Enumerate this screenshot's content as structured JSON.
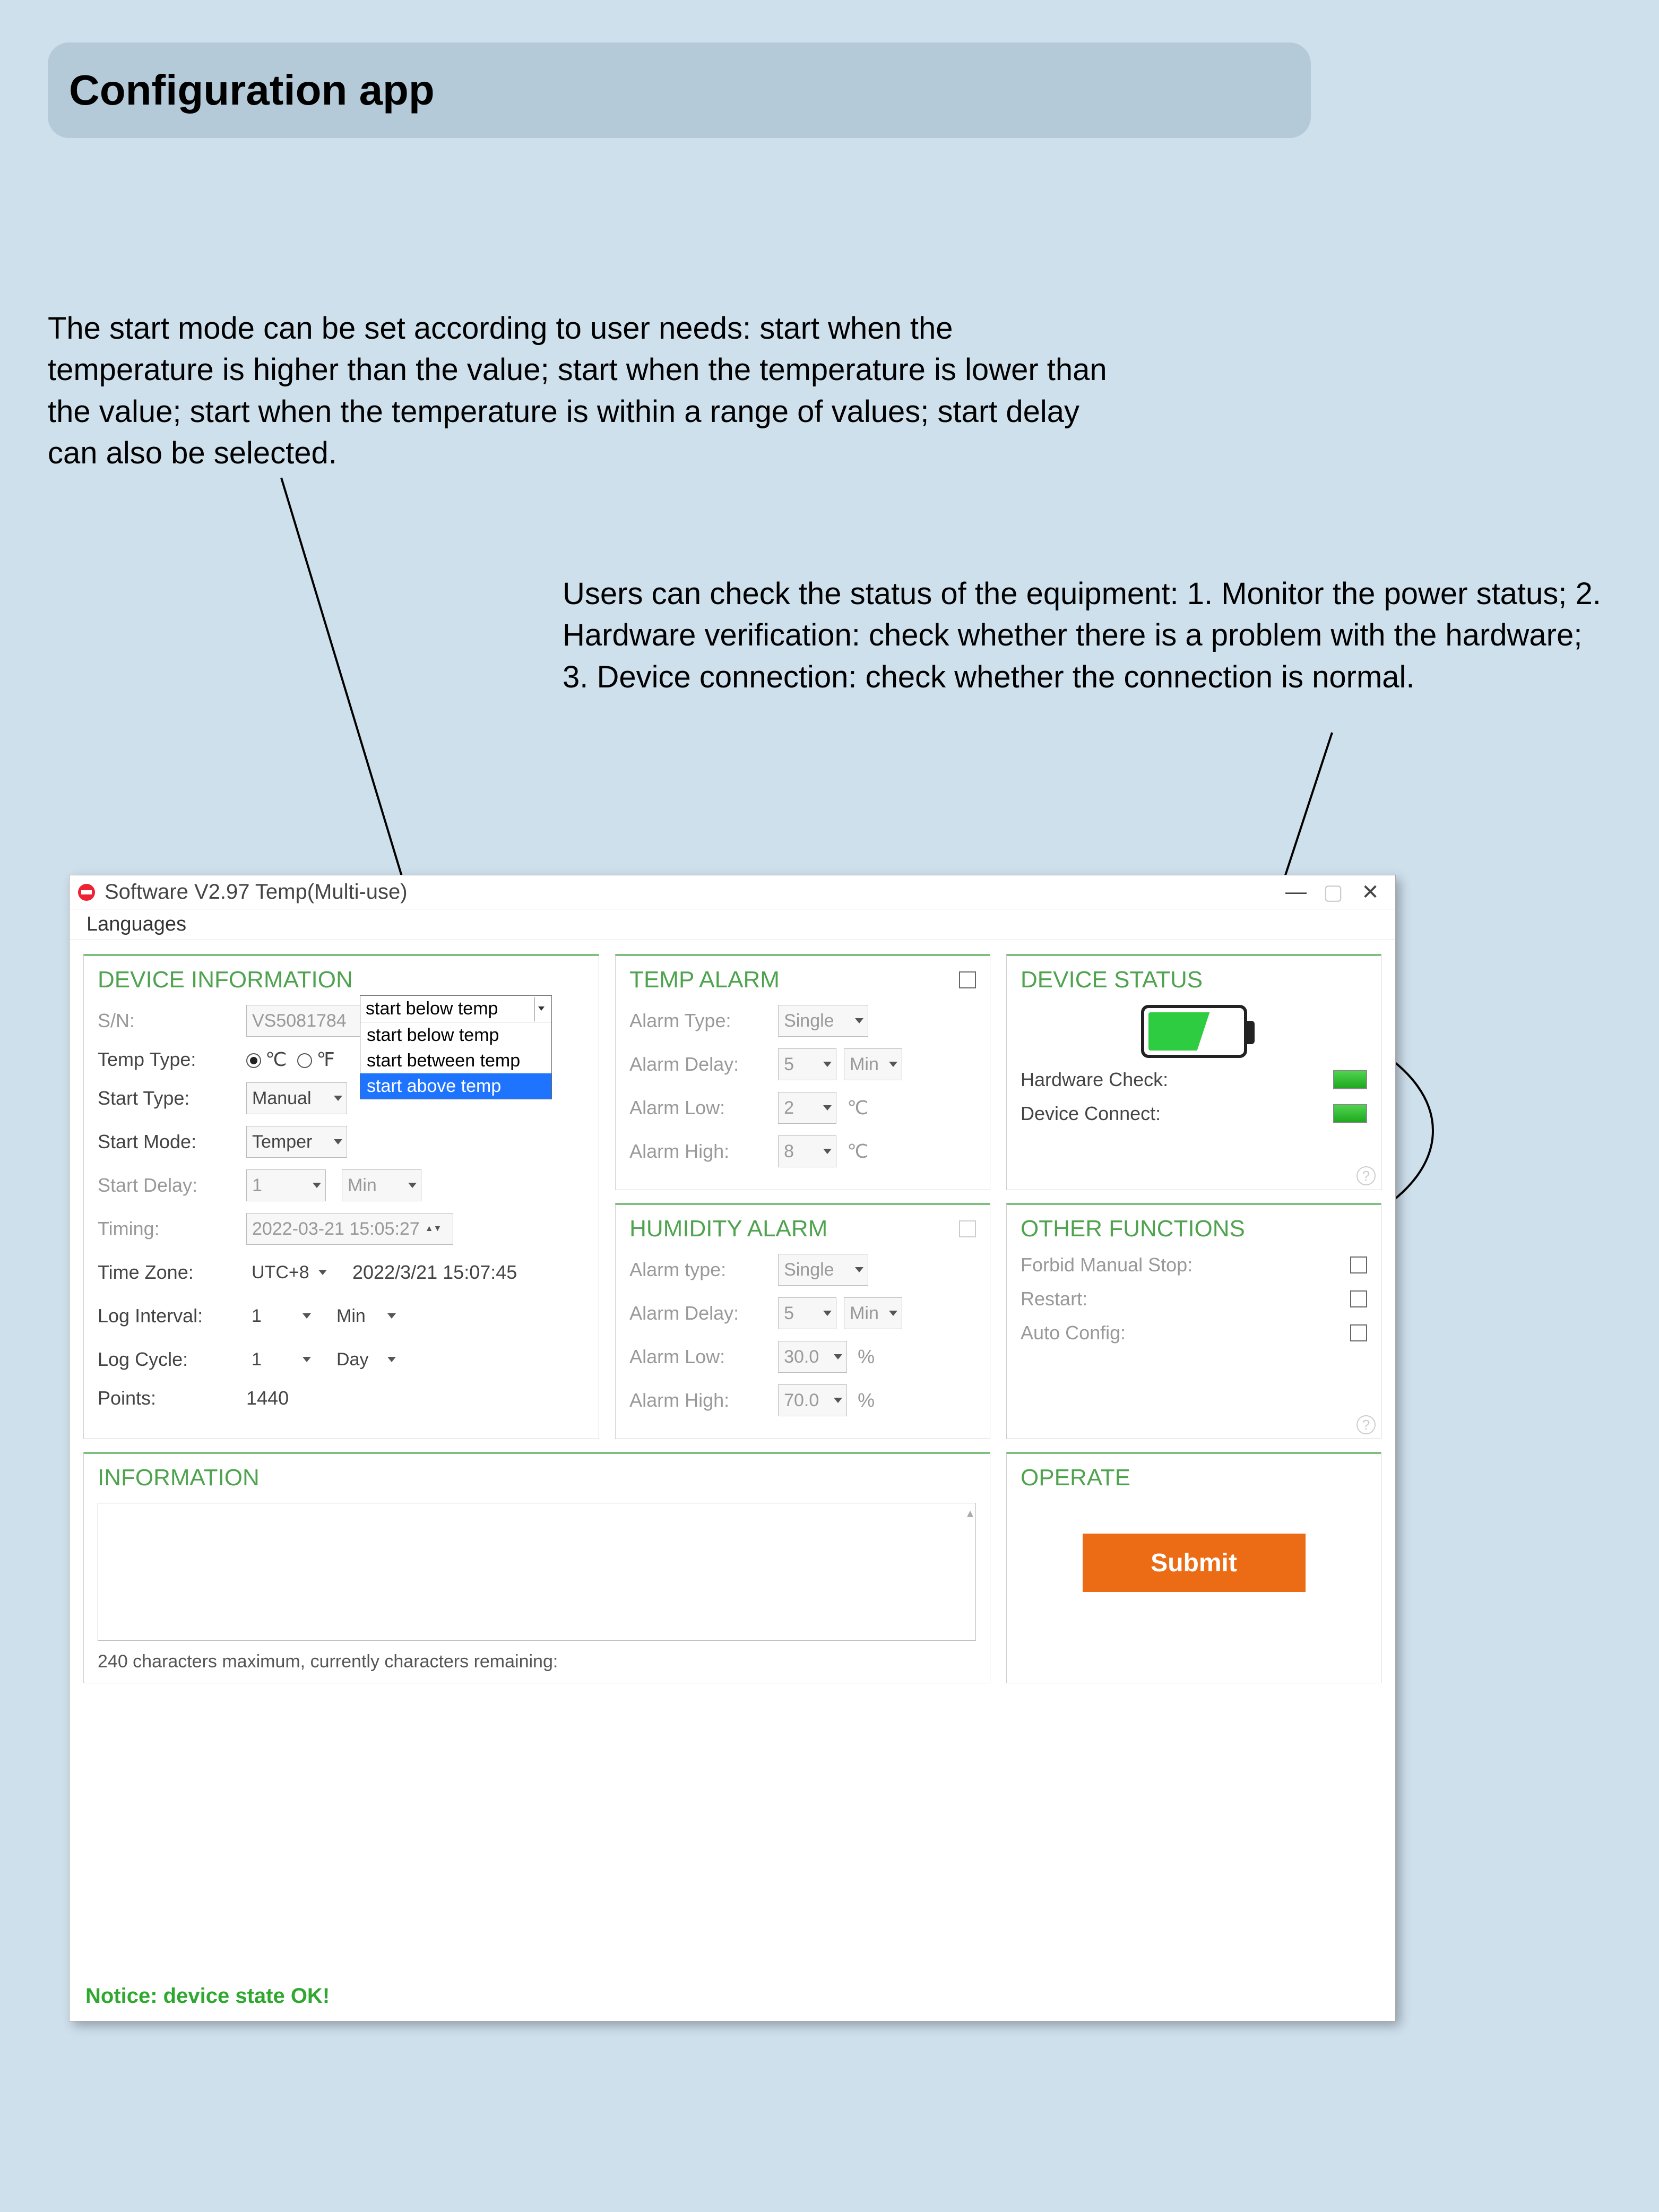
{
  "page": {
    "title": "Configuration app"
  },
  "callouts": {
    "startmode": "The start mode can be set according to user needs: start when the temperature is higher than the value; start when the temperature is lower than the value; start when the temperature is within a range of values; start delay can also be selected.",
    "devstatus": "Users can check the status of the equipment: 1. Monitor the power status; 2. Hardware verification: check whether there is a problem with the hardware; 3. Device connection: check whether the connection is normal."
  },
  "window": {
    "title": "Software V2.97 Temp(Multi-use)",
    "menu": {
      "languages": "Languages"
    }
  },
  "device_info": {
    "title": "DEVICE INFORMATION",
    "sn_label": "S/N:",
    "sn_value": "VS5081784",
    "temp_type_label": "Temp Type:",
    "temp_c": "℃",
    "temp_f": "℉",
    "start_type_label": "Start Type:",
    "start_type_value": "Manual",
    "start_mode_label": "Start Mode:",
    "start_mode_value": "Temper",
    "start_delay_label": "Start Delay:",
    "start_delay_value": "1",
    "start_delay_unit": "Min",
    "timing_label": "Timing:",
    "timing_value": "2022-03-21 15:05:27",
    "timezone_label": "Time Zone:",
    "timezone_value": "UTC+8",
    "timezone_now": "2022/3/21 15:07:45",
    "log_interval_label": "Log Interval:",
    "log_interval_value": "1",
    "log_interval_unit": "Min",
    "log_cycle_label": "Log Cycle:",
    "log_cycle_value": "1",
    "log_cycle_unit": "Day",
    "points_label": "Points:",
    "points_value": "1440"
  },
  "dropdown": {
    "current": "start below temp",
    "opt1": "start below temp",
    "opt2": "start between temp",
    "opt3": "start above temp"
  },
  "temp_alarm": {
    "title": "TEMP ALARM",
    "type_label": "Alarm Type:",
    "type_value": "Single",
    "delay_label": "Alarm Delay:",
    "delay_value": "5",
    "delay_unit": "Min",
    "low_label": "Alarm Low:",
    "low_value": "2",
    "low_unit": "℃",
    "high_label": "Alarm High:",
    "high_value": "8",
    "high_unit": "℃"
  },
  "humidity_alarm": {
    "title": "HUMIDITY ALARM",
    "type_label": "Alarm type:",
    "type_value": "Single",
    "delay_label": "Alarm Delay:",
    "delay_value": "5",
    "delay_unit": "Min",
    "low_label": "Alarm Low:",
    "low_value": "30.0",
    "low_unit": "%",
    "high_label": "Alarm High:",
    "high_value": "70.0",
    "high_unit": "%"
  },
  "device_status": {
    "title": "DEVICE STATUS",
    "hwcheck_label": "Hardware Check:",
    "devconn_label": "Device Connect:"
  },
  "other_fn": {
    "title": "OTHER FUNCTIONS",
    "forbid_label": "Forbid Manual Stop:",
    "restart_label": "Restart:",
    "auto_label": "Auto Config:"
  },
  "information": {
    "title": "INFORMATION",
    "hint": "240 characters maximum, currently characters remaining:"
  },
  "operate": {
    "title": "OPERATE",
    "submit": "Submit"
  },
  "footer": {
    "notice": "Notice: device state OK!"
  }
}
